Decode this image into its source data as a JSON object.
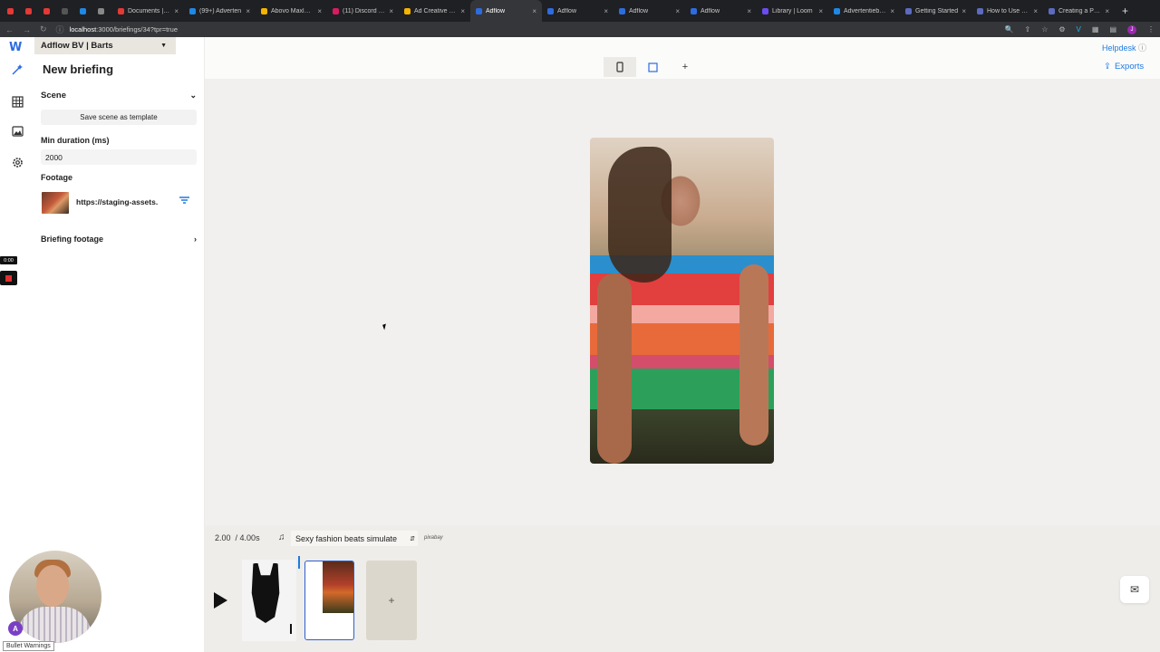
{
  "browser": {
    "tabs": [
      {
        "label": "",
        "active": false,
        "color": "#e53935",
        "small": true
      },
      {
        "label": "",
        "active": false,
        "color": "#e53935",
        "small": true
      },
      {
        "label": "",
        "active": false,
        "color": "#e53935",
        "small": true
      },
      {
        "label": "",
        "active": false,
        "color": "#555555",
        "small": true
      },
      {
        "label": "",
        "active": false,
        "color": "#1e88e5",
        "small": true
      },
      {
        "label": "",
        "active": false,
        "color": "#888888",
        "small": true
      },
      {
        "label": "Documents | H...",
        "active": false,
        "color": "#e53935"
      },
      {
        "label": "(99+) Adverten",
        "active": false,
        "color": "#1e88e5"
      },
      {
        "label": "Abovo Maxlead",
        "active": false,
        "color": "#f4b400"
      },
      {
        "label": "(11) Discord | #...",
        "active": false,
        "color": "#d81b60"
      },
      {
        "label": "Ad Creative Stu",
        "active": false,
        "color": "#f4b400"
      },
      {
        "label": "Adflow",
        "active": true,
        "color": "#2d6cdf"
      },
      {
        "label": "Adflow",
        "active": false,
        "color": "#2d6cdf"
      },
      {
        "label": "Adflow",
        "active": false,
        "color": "#2d6cdf"
      },
      {
        "label": "Adflow",
        "active": false,
        "color": "#2d6cdf"
      },
      {
        "label": "Library | Loom",
        "active": false,
        "color": "#6c4cf2"
      },
      {
        "label": "Advertentiebibli",
        "active": false,
        "color": "#1e88e5"
      },
      {
        "label": "Getting Started",
        "active": false,
        "color": "#5c6bc0"
      },
      {
        "label": "How to Use Pro",
        "active": false,
        "color": "#5c6bc0"
      },
      {
        "label": "Creating a Prod",
        "active": false,
        "color": "#5c6bc0"
      }
    ],
    "url_host": "localhost",
    "url_path": ":3000/briefings/34?tpr=true",
    "profile_initial": "J"
  },
  "sidebar": {
    "org_name": "Adflow BV | Barts",
    "icons": [
      "magic-wand-icon",
      "grid-icon",
      "image-icon",
      "gear-icon"
    ]
  },
  "panel": {
    "title": "New briefing",
    "scene_label": "Scene",
    "save_template_label": "Save scene as template",
    "min_duration_label": "Min duration (ms)",
    "min_duration_value": "2000",
    "footage_label": "Footage",
    "footage_url": "https://staging-assets.",
    "briefing_footage_label": "Briefing footage"
  },
  "recorder": {
    "time": "0:00"
  },
  "topbar": {
    "helpdesk_label": "Helpdesk",
    "exports_label": "Exports"
  },
  "timeline": {
    "current_time": "2.00",
    "total_time": "/ 4.00s",
    "music_track": "Sexy fashion beats simulate",
    "music_source": "pixabay"
  },
  "webcam": {
    "badge": "A",
    "warning_label": "Bullet Warnings"
  }
}
